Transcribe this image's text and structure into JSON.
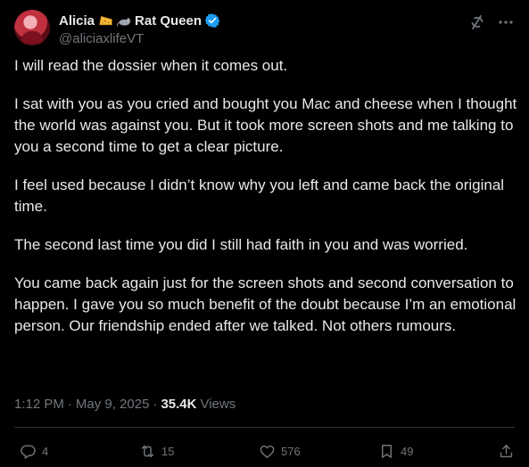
{
  "author": {
    "display_name": "Alicia",
    "display_name_suffix": "Rat Queen",
    "handle": "@aliciaxlifeVT",
    "emoji_icons": [
      "cheese-emoji-icon",
      "rat-emoji-icon"
    ],
    "verified": true,
    "verified_color": "#1d9bf0"
  },
  "post": {
    "paragraphs": [
      "I will read the dossier when it comes out.",
      "I sat with you as you cried and bought you Mac and cheese when I thought the world was against you. But it took more screen shots and me talking to you a second time to get a clear picture.",
      "I feel used because I didn’t know why you left and came back the original time.",
      "The second last time you did I still had faith in you and was worried.",
      "You came back again just for the screen shots and second conversation to happen. I gave you so much benefit of the doubt because I’m an emotional person. Our friendship ended after we talked. Not others rumours."
    ],
    "time": "1:12 PM",
    "separator": "·",
    "date": "May 9, 2025",
    "views_count": "35.4K",
    "views_label": "Views"
  },
  "actions": {
    "replies": "4",
    "reposts": "15",
    "likes": "576",
    "bookmarks": "49"
  },
  "colors": {
    "background": "#000000",
    "text": "#e7e9ea",
    "muted": "#71767b",
    "divider": "#2f3336",
    "accent": "#1d9bf0"
  }
}
